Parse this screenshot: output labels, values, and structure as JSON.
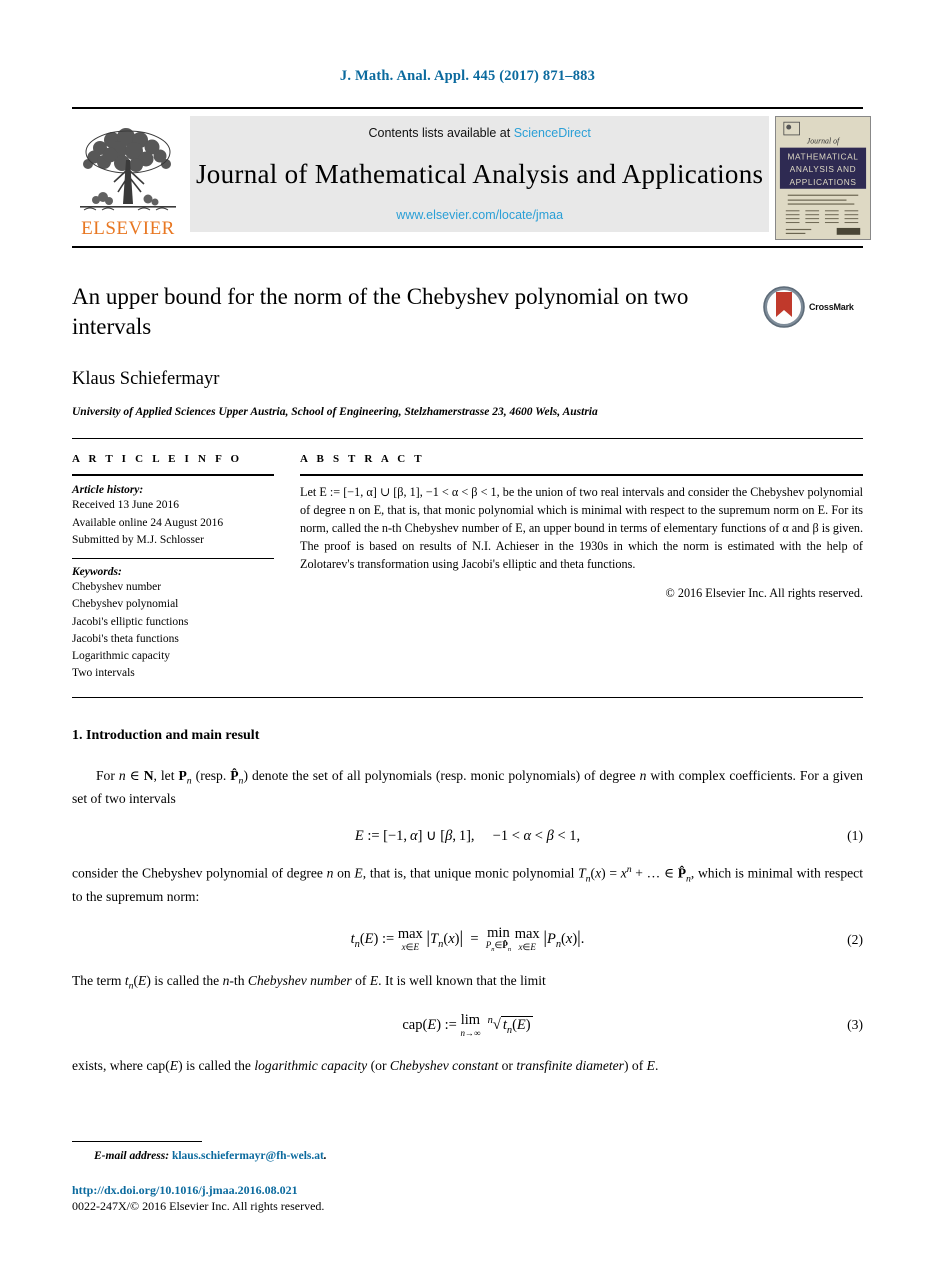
{
  "running_head": "J. Math. Anal. Appl. 445 (2017) 871–883",
  "masthead": {
    "publisher_name": "ELSEVIER",
    "contents_prefix": "Contents lists available at",
    "contents_link": "ScienceDirect",
    "journal_title": "Journal of Mathematical Analysis and Applications",
    "journal_url": "www.elsevier.com/locate/jmaa",
    "cover": {
      "small_top": "Journal of",
      "band_line1": "MATHEMATICAL",
      "band_line2": "ANALYSIS AND",
      "band_line3": "APPLICATIONS"
    }
  },
  "article": {
    "title": "An upper bound for the norm of the Chebyshev polynomial on two intervals",
    "crossmark_label": "CrossMark",
    "author": "Klaus Schiefermayr",
    "affiliation": "University of Applied Sciences Upper Austria, School of Engineering, Stelzhamerstrasse 23, 4600 Wels, Austria"
  },
  "article_info": {
    "heading": "A R T I C L E    I N F O",
    "history_heading": "Article history:",
    "history": [
      "Received 13 June 2016",
      "Available online 24 August 2016",
      "Submitted by M.J. Schlosser"
    ],
    "keywords_heading": "Keywords:",
    "keywords": [
      "Chebyshev number",
      "Chebyshev polynomial",
      "Jacobi's elliptic functions",
      "Jacobi's theta functions",
      "Logarithmic capacity",
      "Two intervals"
    ]
  },
  "abstract": {
    "heading": "A B S T R A C T",
    "text": "Let E := [−1, α] ∪ [β, 1], −1 < α < β < 1, be the union of two real intervals and consider the Chebyshev polynomial of degree n on E, that is, that monic polynomial which is minimal with respect to the supremum norm on E. For its norm, called the n-th Chebyshev number of E, an upper bound in terms of elementary functions of α and β is given. The proof is based on results of N.I. Achieser in the 1930s in which the norm is estimated with the help of Zolotarev's transformation using Jacobi's elliptic and theta functions.",
    "copyright": "© 2016 Elsevier Inc. All rights reserved."
  },
  "body": {
    "section_title": "1. Introduction and main result",
    "paragraph_1": "For n ∈ ℕ, let ℙn (resp. ℙ̂n) denote the set of all polynomials (resp. monic polynomials) of degree n with complex coefficients. For a given set of two intervals",
    "equation_1": "E := [−1, α] ∪ [β, 1],      −1 < α < β < 1,",
    "equation_1_number": "(1)",
    "paragraph_2": "consider the Chebyshev polynomial of degree n on E, that is, that unique monic polynomial Tn(x) = xⁿ + … ∈ ℙ̂n, which is minimal with respect to the supremum norm:",
    "equation_2": "tn(E) := max |Tn(x)| = min max |Pn(x)|.",
    "equation_2_number": "(2)",
    "paragraph_3": "The term tn(E) is called the n-th Chebyshev number of E. It is well known that the limit",
    "equation_3": "cap(E) := lim ⁿ√tn(E)",
    "equation_3_number": "(3)",
    "paragraph_4": "exists, where cap(E) is called the logarithmic capacity (or Chebyshev constant or transfinite diameter) of E."
  },
  "footer": {
    "email_label": "E-mail address:",
    "email": "klaus.schiefermayr@fh-wels.at",
    "email_suffix": ".",
    "doi": "http://dx.doi.org/10.1016/j.jmaa.2016.08.021",
    "issn_copyright": "0022-247X/© 2016 Elsevier Inc. All rights reserved."
  },
  "colors": {
    "link_blue": "#2a9fd6",
    "header_blue": "#0b6a9e",
    "elsevier_orange": "#e87722",
    "band_gray": "#e8e8e8",
    "cover_beige": "#ded9c4",
    "cover_navy": "#2e2a52",
    "crossmark_red": "#c0392b"
  }
}
